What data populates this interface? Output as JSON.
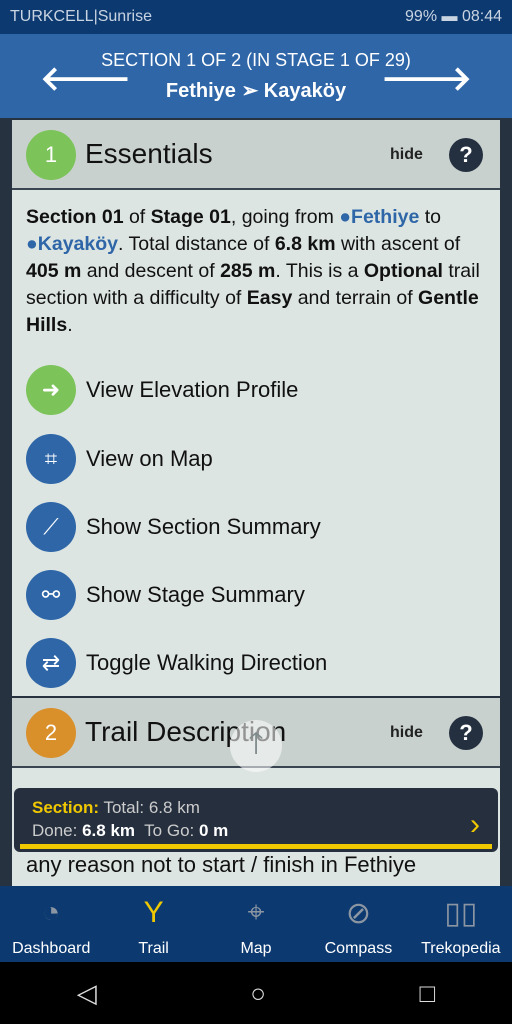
{
  "status_bar": {
    "carrier": "TURKCELL|Sunrise",
    "battery": "99%",
    "time": "08:44"
  },
  "header": {
    "subtitle": "SECTION 1 OF 2 (IN STAGE 1 OF 29)",
    "title": "Fethiye ➢ Kayaköy",
    "prev_icon": "arrow-left",
    "next_icon": "arrow-right"
  },
  "essentials": {
    "number": "1",
    "title": "Essentials",
    "hide": "hide",
    "help": "?",
    "color": "#7cc35a",
    "desc": {
      "p1": "Section 01",
      "p2": " of ",
      "p3": "Stage 01",
      "p4": ", going from ",
      "from": "Fethiye",
      "p5": " to ",
      "to": "Kayaköy",
      "p6": ". Total distance of ",
      "distance": "6.8 km",
      "p7": " with ascent of ",
      "ascent": "405 m",
      "p8": " and descent of ",
      "descent": "285 m",
      "p9": ". This is a ",
      "type": "Optional",
      "p10": " trail section with a difficulty of ",
      "difficulty": "Easy",
      "p11": " and terrain of ",
      "terrain": "Gentle Hills",
      "p12": "."
    },
    "actions": [
      {
        "label": "View Elevation Profile",
        "icon": "arrow-right-circle"
      },
      {
        "label": "View on Map",
        "icon": "map"
      },
      {
        "label": "Show Section Summary",
        "icon": "line"
      },
      {
        "label": "Show Stage Summary",
        "icon": "link"
      },
      {
        "label": "Toggle Walking Direction",
        "icon": "swap"
      }
    ]
  },
  "trail_description": {
    "number": "2",
    "title": "Trail Description",
    "hide": "hide",
    "help": "?",
    "color": "#d98f2a",
    "text": "any reason not to start / finish in Fethiye"
  },
  "overlay": {
    "section_label": "Section:",
    "total": " Total: 6.8 km",
    "done_label": "Done: ",
    "done": "6.8 km",
    "togo_label": "  To Go: ",
    "togo": "0 m",
    "progress": 1.0,
    "accent": "#f0c800"
  },
  "bottom_nav": [
    {
      "label": "Dashboard",
      "icon": "speedometer"
    },
    {
      "label": "Trail",
      "icon": "trail-fork",
      "active": true
    },
    {
      "label": "Map",
      "icon": "map-pin"
    },
    {
      "label": "Compass",
      "icon": "compass"
    },
    {
      "label": "Trekopedia",
      "icon": "book"
    }
  ]
}
